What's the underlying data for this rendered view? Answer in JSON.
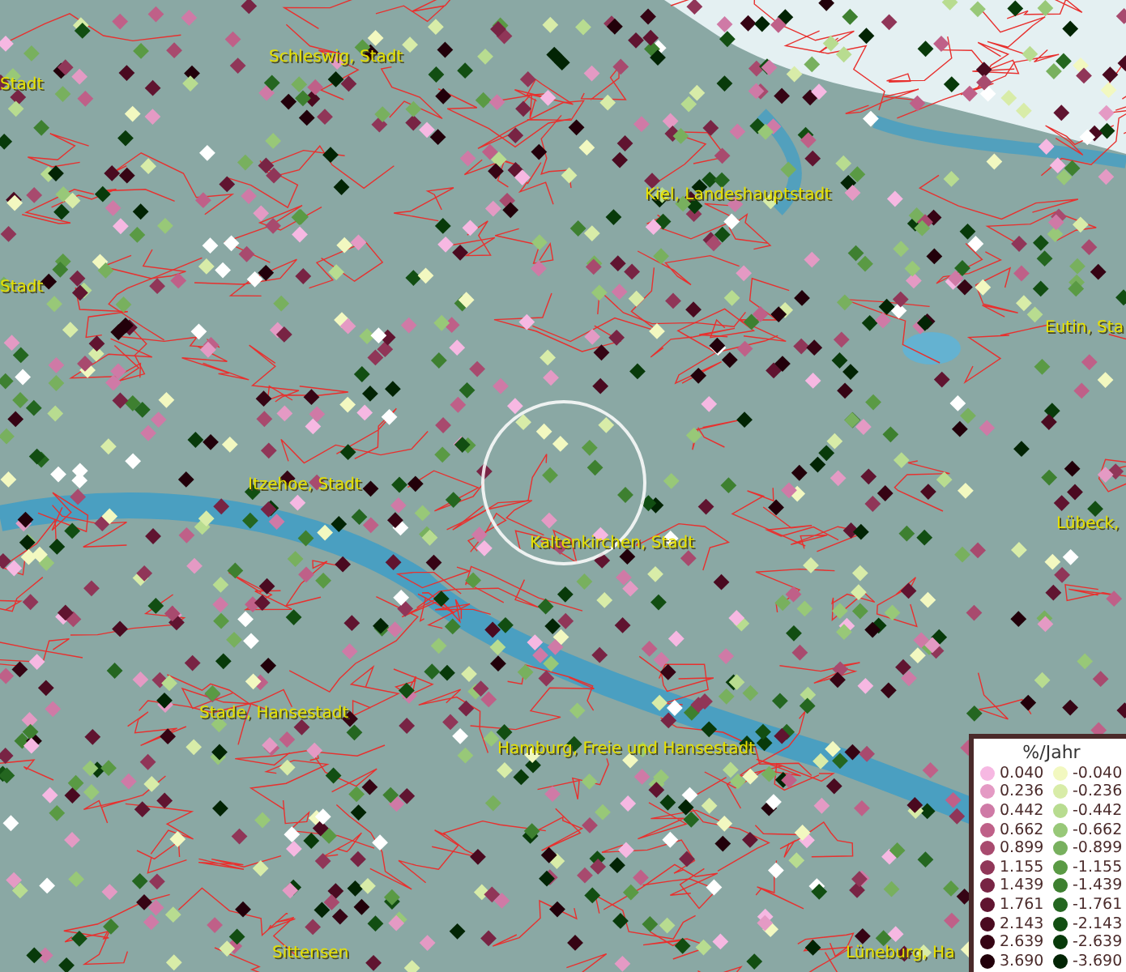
{
  "map": {
    "places": [
      {
        "name": "Schleswig, Stadt"
      },
      {
        "name": "Stadt"
      },
      {
        "name": "Stadt"
      },
      {
        "name": "Kiel, Landeshauptstadt"
      },
      {
        "name": "Eutin, Sta"
      },
      {
        "name": "Itzehoe, Stadt"
      },
      {
        "name": "Kaltenkirchen, Stadt"
      },
      {
        "name": "Lübeck,"
      },
      {
        "name": "Stade, Hansestadt"
      },
      {
        "name": "Hamburg, Freie und Hansestadt"
      },
      {
        "name": "Sittensen"
      },
      {
        "name": "Lüneburg, Ha"
      }
    ]
  },
  "legend": {
    "title": "%/Jahr",
    "items": [
      {
        "label": "0.040",
        "color": "#f6b8e2"
      },
      {
        "label": "-0.040",
        "color": "#f2f8c0"
      },
      {
        "label": "0.236",
        "color": "#e49ac4"
      },
      {
        "label": "-0.236",
        "color": "#d8eca8"
      },
      {
        "label": "0.442",
        "color": "#cf7aa6"
      },
      {
        "label": "-0.442",
        "color": "#b8dc90"
      },
      {
        "label": "0.662",
        "color": "#bf6088"
      },
      {
        "label": "-0.662",
        "color": "#98c878"
      },
      {
        "label": "0.899",
        "color": "#a84a6e"
      },
      {
        "label": "-0.899",
        "color": "#78b05e"
      },
      {
        "label": "1.155",
        "color": "#903658"
      },
      {
        "label": "-1.155",
        "color": "#5a9a44"
      },
      {
        "label": "1.439",
        "color": "#782444"
      },
      {
        "label": "-1.439",
        "color": "#3e8030"
      },
      {
        "label": "1.761",
        "color": "#601430"
      },
      {
        "label": "-1.761",
        "color": "#246620"
      },
      {
        "label": "2.143",
        "color": "#4a0a20"
      },
      {
        "label": "-2.143",
        "color": "#124e12"
      },
      {
        "label": "2.639",
        "color": "#360414"
      },
      {
        "label": "-2.639",
        "color": "#083a0a"
      },
      {
        "label": "3.690",
        "color": "#22000a"
      },
      {
        "label": "-3.690",
        "color": "#022404"
      }
    ]
  }
}
